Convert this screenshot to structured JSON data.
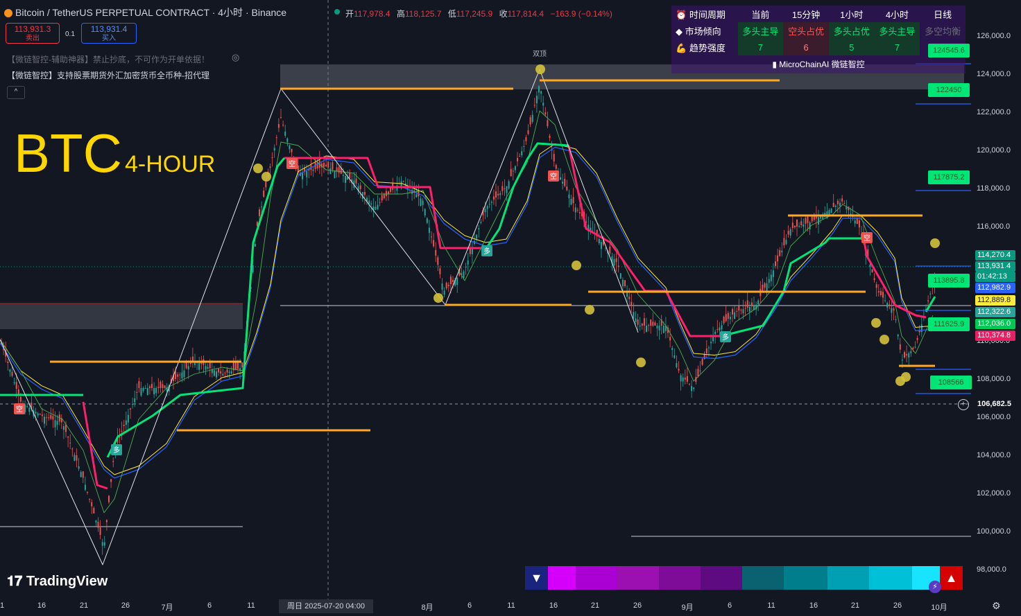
{
  "header": {
    "symbol": "Bitcoin / TetherUS PERPETUAL CONTRACT · 4小时 · Binance",
    "ohlc": [
      {
        "label": "开",
        "value": "117,978.4"
      },
      {
        "label": "高",
        "value": "118,125.7"
      },
      {
        "label": "低",
        "value": "117,245.9"
      },
      {
        "label": "收",
        "value": "117,814.4"
      }
    ],
    "change": "−163.9 (−0.14%)"
  },
  "trade": {
    "sell_price": "113,931.3",
    "sell_label": "卖出",
    "spread": "0.1",
    "buy_price": "113,931.4",
    "buy_label": "买入"
  },
  "notes": {
    "line1": "【微链智控-辅助神器】禁止抄底，不可作为开单依据！",
    "line2": "【微链智控】支持股票期货外汇加密货币全币种-招代理"
  },
  "watermark": {
    "title": "BTC",
    "timeframe": "4-HOUR"
  },
  "pattern_label": "双顶",
  "signals": {
    "short": "空",
    "long": "多"
  },
  "table": {
    "headers": [
      "时间周期",
      "当前",
      "15分钟",
      "1小时",
      "4小时",
      "日线"
    ],
    "row_direction": {
      "label": "市场倾向",
      "values": [
        "多头主导",
        "空头占优",
        "多头占优",
        "多头主导",
        "多空均衡"
      ]
    },
    "row_strength": {
      "label": "趋势强度",
      "values": [
        "7",
        "6",
        "5",
        "7",
        ""
      ]
    },
    "footer": "MicroChainAI 微链智控"
  },
  "y_axis": [
    "126,000.0",
    "124,000.0",
    "122,000.0",
    "120,000.0",
    "118,000.0",
    "116,000.0",
    "114,000.0",
    "112,000.0",
    "110,000.0",
    "108,000.0",
    "106,000.0",
    "104,000.0",
    "102,000.0",
    "100,000.0",
    "98,000.0"
  ],
  "x_axis": [
    "1",
    "16",
    "21",
    "26",
    "7月",
    "6",
    "11",
    "8月",
    "6",
    "11",
    "16",
    "21",
    "26",
    "9月",
    "6",
    "11",
    "16",
    "21",
    "26",
    "10月"
  ],
  "crosshair_date": "周日 2025-07-20   04:00",
  "price_tags": [
    {
      "text": "114,270.4",
      "color": "#089981"
    },
    {
      "text": "113,931.4",
      "color": "#089981"
    },
    {
      "text": "01:42:13",
      "color": "#089981"
    },
    {
      "text": "112,982.9",
      "color": "#2962ff"
    },
    {
      "text": "112,889.8",
      "color": "#ffeb3b"
    },
    {
      "text": "112,322.6",
      "color": "#26a69a"
    },
    {
      "text": "112,036.0",
      "color": "#00c853"
    },
    {
      "text": "110,374.8",
      "color": "#e91e63"
    }
  ],
  "crosshair_price": "106,682.5",
  "level_tags": [
    "124545.6",
    "122450",
    "117875.2",
    "113895.8",
    "111625.9",
    "108566"
  ],
  "branding": "TradingView",
  "colors": {
    "bg": "#131722",
    "up": "#26a69a",
    "down": "#ef5350",
    "stop_up": "#00e676",
    "stop_down": "#ff1f6b",
    "level": "#ffa726",
    "dot": "#d4c13a"
  }
}
